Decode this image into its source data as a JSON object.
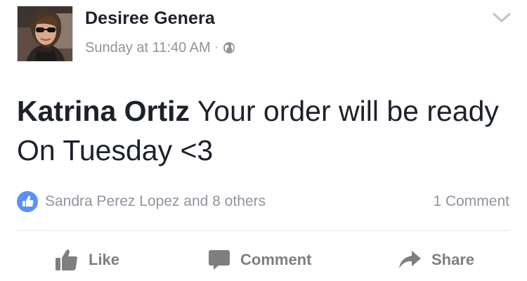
{
  "post": {
    "author_name": "Desiree Genera",
    "timestamp": "Sunday at 11:40 AM",
    "separator": "·",
    "privacy_icon": "globe-icon",
    "menu_icon": "chevron-down-icon",
    "message": {
      "mention": "Katrina Ortiz",
      "text": " Your order will be ready On Tuesday <3"
    },
    "reactions": {
      "icon": "like-badge-icon",
      "likers_text": "Sandra Perez Lopez and 8 others",
      "comments_count_text": "1 Comment"
    },
    "actions": {
      "like_label": "Like",
      "like_icon": "thumbs-up-icon",
      "comment_label": "Comment",
      "comment_icon": "speech-bubble-icon",
      "share_label": "Share",
      "share_icon": "share-arrow-icon"
    }
  },
  "colors": {
    "primary_text": "#1d2129",
    "secondary_text": "#90949c",
    "action_text": "#7f7f7f",
    "like_blue": "#5890ff",
    "divider": "#e5e6e9"
  }
}
